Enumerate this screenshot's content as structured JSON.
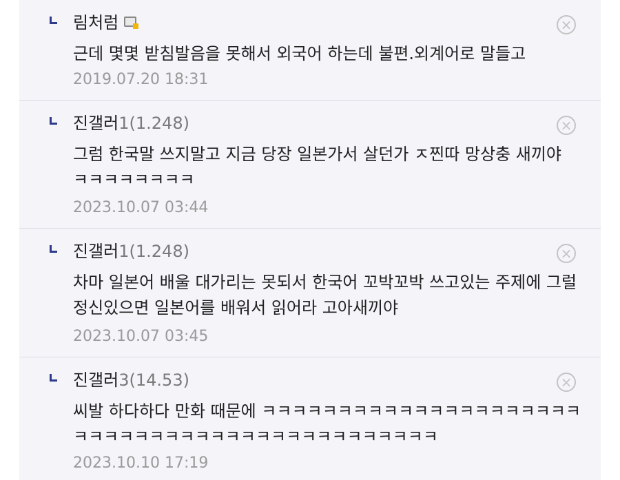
{
  "comments": [
    {
      "nickname": "림처럼",
      "ip": "",
      "text": "근데 몇몇 받침발음을 못해서 외국어 하는데 불편.외계어로 말들고",
      "timestamp": "2019.07.20 18:31",
      "badge_icon": "gallery-badge-icon"
    },
    {
      "nickname": "진갤러",
      "ip": "1(1.248)",
      "text": "그럼 한국말 쓰지말고 지금 당장 일본가서 살던가 ㅈ찐따 망상충 새끼야 ㅋㅋㅋㅋㅋㅋㅋㅋ",
      "timestamp": "2023.10.07 03:44"
    },
    {
      "nickname": "진갤러",
      "ip": "1(1.248)",
      "text": "차마 일본어 배울 대가리는 못되서 한국어 꼬박꼬박 쓰고있는 주제에 그럴 정신있으면 일본어를 배워서 읽어라 고아새끼야",
      "timestamp": "2023.10.07 03:45"
    },
    {
      "nickname": "진갤러",
      "ip": "3(14.53)",
      "text": "씨발 하다하다 만화 때문에 ㅋㅋㅋㅋㅋㅋㅋㅋㅋㅋㅋㅋㅋㅋㅋㅋㅋㅋㅋㅋㅋㅋㅋㅋㅋㅋㅋㅋㅋㅋㅋㅋㅋㅋㅋㅋㅋㅋㅋㅋㅋㅋㅋㅋㅋ",
      "timestamp": "2023.10.10 17:19"
    }
  ],
  "icons": {
    "reply": "reply-arrow-icon",
    "delete": "close-circle-icon",
    "delete_glyph": "×"
  },
  "colors": {
    "panel_background": "#f4f4f9",
    "reply_icon": "#2e3a8c",
    "timestamp": "#9a9a9a",
    "ip": "#7a7a7a"
  }
}
